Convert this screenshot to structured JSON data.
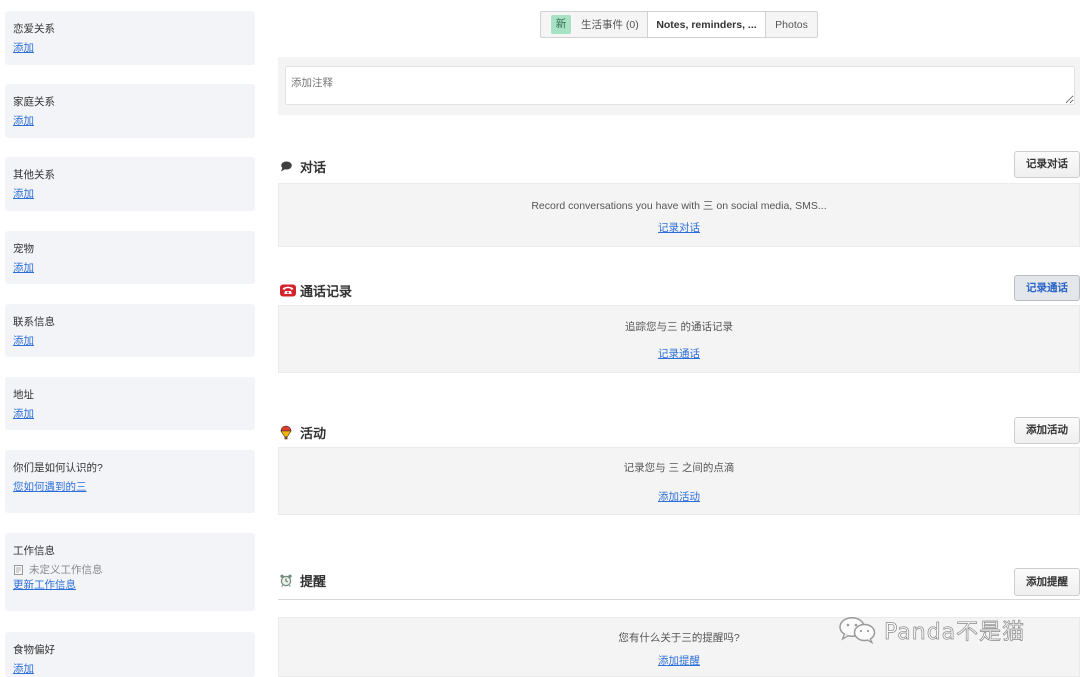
{
  "colors": {
    "link": "#2d6fd8",
    "card_bg": "#f3f4f8",
    "badge_bg": "#a8e2c5",
    "badge_text": "#2f6b4b",
    "phone_icon": "#d4232f"
  },
  "sidebar": {
    "cards": [
      {
        "title": "恋爱关系",
        "link": "添加"
      },
      {
        "title": "家庭关系",
        "link": "添加"
      },
      {
        "title": "其他关系",
        "link": "添加"
      },
      {
        "title": "宠物",
        "link": "添加"
      },
      {
        "title": "联系信息",
        "link": "添加"
      },
      {
        "title": "地址",
        "link": "添加"
      },
      {
        "title": "你们是如何认识的?",
        "link": "您如何遇到的三"
      },
      {
        "title": "工作信息",
        "note_icon": "document-icon",
        "note": "未定义工作信息",
        "link": "更新工作信息"
      },
      {
        "title": "食物偏好",
        "link": "添加"
      }
    ]
  },
  "tabs": [
    {
      "badge": "新",
      "label": "生活事件 (0)"
    },
    {
      "label": "Notes, reminders, ..."
    },
    {
      "label": "Photos"
    }
  ],
  "notes": {
    "placeholder": "添加注释"
  },
  "sections": {
    "conversations": {
      "icon": "speech-bubble-icon",
      "title": "对话",
      "button": "记录对话",
      "message": "Record conversations you have with 三 on social media, SMS...",
      "link": "记录对话"
    },
    "calls": {
      "icon": "telephone-icon",
      "title": "通话记录",
      "button": "记录通话",
      "message": "追踪您与三 的通话记录",
      "link": "记录通话"
    },
    "activities": {
      "icon": "activity-icon",
      "title": "活动",
      "button": "添加活动",
      "message": "记录您与 三 之间的点滴",
      "link": "添加活动"
    },
    "reminders": {
      "icon": "alarm-clock-icon",
      "title": "提醒",
      "button": "添加提醒",
      "message": "您有什么关于三的提醒吗?",
      "link": "添加提醒"
    }
  },
  "watermark": {
    "icon": "wechat-icon",
    "text": "Panda不是猫"
  }
}
